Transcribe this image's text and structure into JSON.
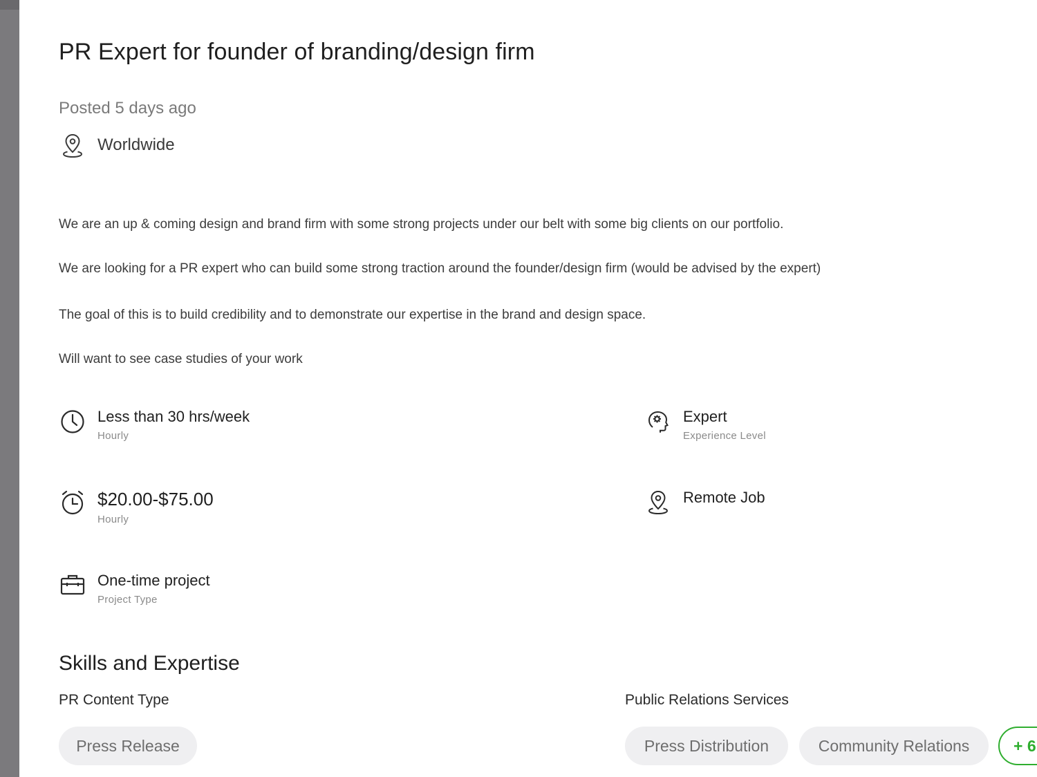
{
  "job": {
    "title": "PR Expert for founder of branding/design firm",
    "posted": "Posted 5 days ago",
    "location": "Worldwide",
    "description": [
      "We are an up & coming design and brand firm with some strong projects under our belt with some big clients on our portfolio.",
      "We are looking for a PR expert who can build some strong traction around the founder/design firm (would be advised by the expert)",
      "The goal of this is to build credibility and to demonstrate our expertise in the brand and design space.",
      "Will want to see case studies of your work"
    ],
    "features": {
      "hours": {
        "main": "Less than 30 hrs/week",
        "sub": "Hourly",
        "icon": "clock-icon"
      },
      "experience": {
        "main": "Expert",
        "sub": "Experience Level",
        "icon": "brain-gear-icon"
      },
      "rate": {
        "main": "$20.00-$75.00",
        "sub": "Hourly",
        "icon": "stopwatch-icon"
      },
      "remote": {
        "main": "Remote Job",
        "icon": "location-pin-icon"
      },
      "project": {
        "main": "One-time project",
        "sub": "Project Type",
        "icon": "briefcase-icon"
      }
    }
  },
  "skills": {
    "title": "Skills and Expertise",
    "groups": [
      {
        "title": "PR Content Type",
        "chips": [
          "Press Release"
        ]
      },
      {
        "title": "Public Relations Services",
        "chips": [
          "Press Distribution",
          "Community Relations"
        ],
        "more": "+ 6"
      }
    ]
  },
  "colors": {
    "sidebar": "#7b7a7d",
    "chip_bg": "#efeff1",
    "accent_green": "#2fae2f"
  }
}
